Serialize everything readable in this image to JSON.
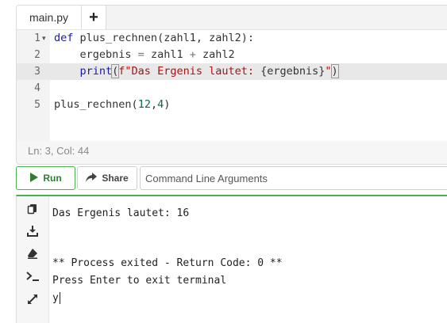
{
  "editor": {
    "tab_label": "main.py",
    "add_tab_symbol": "+",
    "line_numbers": [
      "1",
      "2",
      "3",
      "4",
      "5"
    ],
    "code": {
      "l1_kw": "def",
      "l1_name": "plus_rechnen",
      "l1_rest": "(zahl1, zahl2):",
      "l2_indent": "    ",
      "l2_var": "ergebnis",
      "l2_eq": " = ",
      "l2_a": "zahl1",
      "l2_plus": " + ",
      "l2_b": "zahl2",
      "l3_indent": "    ",
      "l3_fn": "print",
      "l3_open": "(",
      "l3_str": "f\"Das Ergenis lautet: ",
      "l3_fmt": "{ergebnis}",
      "l3_strend": "\"",
      "l3_close": ")",
      "l5_name": "plus_rechnen",
      "l5_open": "(",
      "l5_n1": "12",
      "l5_comma": ",",
      "l5_n2": "4",
      "l5_close": ")"
    },
    "status": "Ln: 3,  Col: 44"
  },
  "toolbar": {
    "run_label": "Run",
    "share_label": "Share",
    "args_placeholder": "Command Line Arguments"
  },
  "terminal": {
    "lines": [
      "Das Ergenis lautet: 16",
      "",
      "",
      "** Process exited - Return Code: 0 **",
      "Press Enter to exit terminal",
      "y"
    ],
    "side_icons": [
      "copy-icon",
      "download-icon",
      "clear-icon",
      "terminal-prompt-icon",
      "expand-icon"
    ]
  },
  "colors": {
    "accent_green": "#4caf50",
    "keyword_blue": "#1a1aa6",
    "string_red": "#aa1111",
    "number_green": "#116644"
  }
}
